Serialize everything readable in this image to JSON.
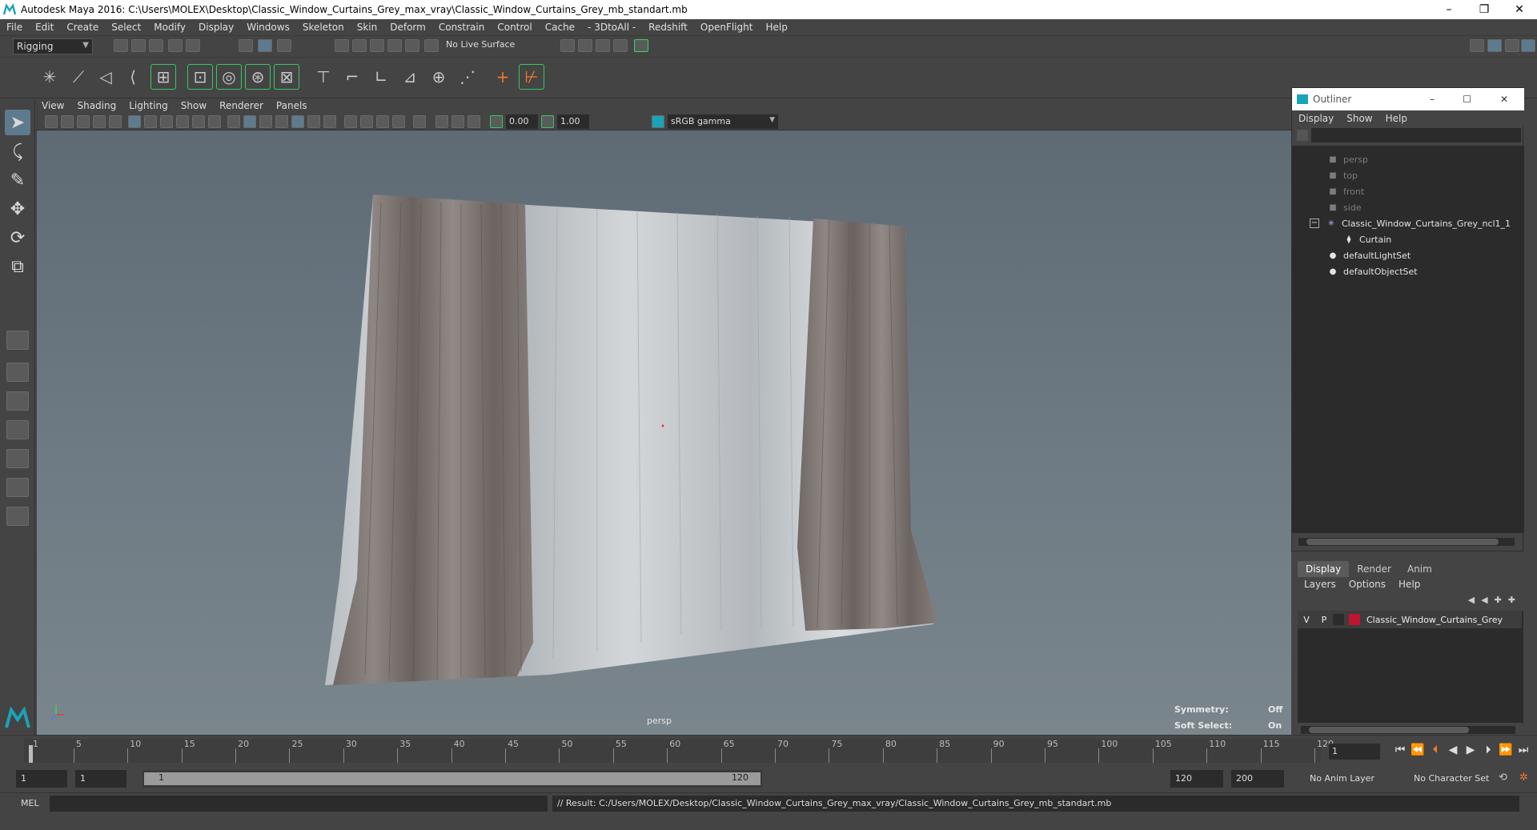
{
  "window": {
    "title": "Autodesk Maya 2016: C:\\Users\\MOLEX\\Desktop\\Classic_Window_Curtains_Grey_max_vray\\Classic_Window_Curtains_Grey_mb_standart.mb",
    "minimize": "–",
    "restore": "❐",
    "close": "✕"
  },
  "menubar": [
    "File",
    "Edit",
    "Create",
    "Select",
    "Modify",
    "Display",
    "Windows",
    "Skeleton",
    "Skin",
    "Deform",
    "Constrain",
    "Control",
    "Cache",
    "- 3DtoAll -",
    "Redshift",
    "OpenFlight",
    "Help"
  ],
  "statusline": {
    "mode": "Rigging",
    "live_surface": "No Live Surface"
  },
  "panel": {
    "menu": [
      "View",
      "Shading",
      "Lighting",
      "Show",
      "Renderer",
      "Panels"
    ],
    "near_clip": "0.00",
    "far_clip": "1.00",
    "color_space": "sRGB gamma"
  },
  "viewport": {
    "camera": "persp",
    "symmetry_label": "Symmetry:",
    "symmetry_value": "Off",
    "soft_select_label": "Soft Select:",
    "soft_select_value": "On",
    "colors": {
      "sheer": "#c9cdd0",
      "drape": "#7d7470"
    }
  },
  "outliner": {
    "title": "Outliner",
    "menu": [
      "Display",
      "Show",
      "Help"
    ],
    "items": [
      {
        "label": "persp",
        "icon": "camera-icon",
        "dim": true
      },
      {
        "label": "top",
        "icon": "camera-icon",
        "dim": true
      },
      {
        "label": "front",
        "icon": "camera-icon",
        "dim": true
      },
      {
        "label": "side",
        "icon": "camera-icon",
        "dim": true
      },
      {
        "label": "Classic_Window_Curtains_Grey_ncl1_1",
        "icon": "joint-icon",
        "dim": false,
        "expanded": "−"
      },
      {
        "label": "Curtain",
        "icon": "mesh-icon",
        "dim": false,
        "child": true
      },
      {
        "label": "defaultLightSet",
        "icon": "set-icon",
        "dim": false
      },
      {
        "label": "defaultObjectSet",
        "icon": "set-icon",
        "dim": false
      }
    ]
  },
  "layers": {
    "tabs": [
      "Display",
      "Render",
      "Anim"
    ],
    "active_tab": "Display",
    "menu": [
      "Layers",
      "Options",
      "Help"
    ],
    "rows": [
      {
        "v": "V",
        "p": "P",
        "name": "Classic_Window_Curtains_Grey",
        "color": "#c0152f"
      }
    ]
  },
  "timeline": {
    "ticks": [
      "1",
      "5",
      "10",
      "15",
      "20",
      "25",
      "30",
      "35",
      "40",
      "45",
      "50",
      "55",
      "60",
      "65",
      "70",
      "75",
      "80",
      "85",
      "90",
      "95",
      "100",
      "105",
      "110",
      "115",
      "120"
    ],
    "current_frame": "1"
  },
  "range": {
    "start": "1",
    "playback_start": "1",
    "slider_start": "1",
    "slider_end": "120",
    "playback_end": "120",
    "end": "200",
    "anim_layer": "No Anim Layer",
    "character_set": "No Character Set"
  },
  "command": {
    "lang": "MEL",
    "result": "// Result: C:/Users/MOLEX/Desktop/Classic_Window_Curtains_Grey_max_vray/Classic_Window_Curtains_Grey_mb_standart.mb"
  }
}
